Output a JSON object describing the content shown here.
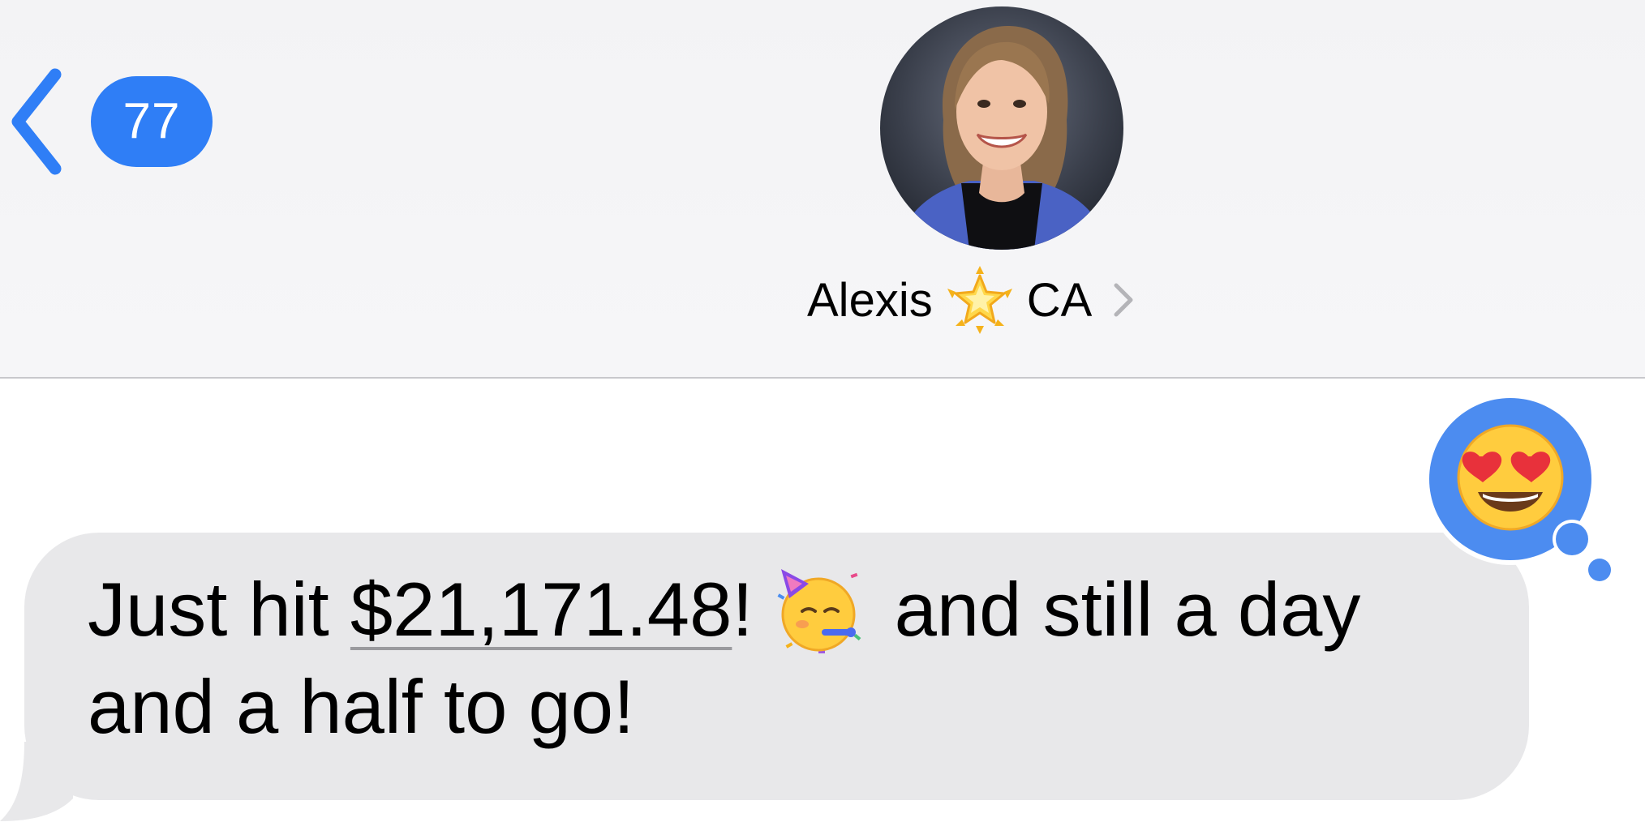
{
  "nav": {
    "unread_count": "77"
  },
  "contact": {
    "name": "Alexis",
    "name_emoji_icon": "glowing-star-icon",
    "suffix": "CA",
    "avatar_icon": "contact-photo"
  },
  "message": {
    "text_before": "Just hit ",
    "amount": "$21,171.48",
    "text_after_amount": "!",
    "emoji_icon": "partying-face-icon",
    "text_after_emoji": " and still a day",
    "line2": "and a half to go!"
  },
  "tapback": {
    "emoji_icon": "heart-eyes-icon"
  },
  "colors": {
    "accent": "#2f7ef6",
    "header_bg": "#f5f5f7",
    "bubble_bg": "#e8e8ea",
    "divider": "#c8c8cc"
  }
}
